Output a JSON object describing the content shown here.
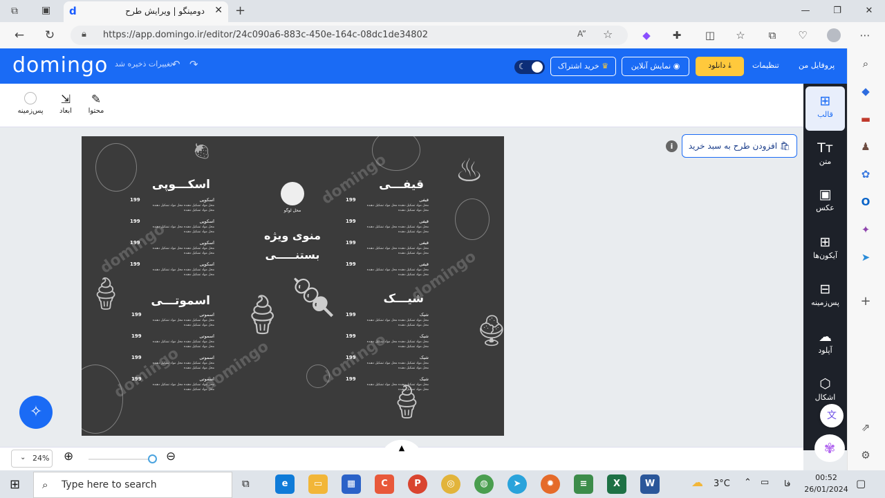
{
  "browser": {
    "tab_title": "دومینگو | ویرایش طرح",
    "url": "https://app.domingo.ir/editor/24c090a6-883c-450e-164c-08dc1de34802"
  },
  "header": {
    "logo": "domingo",
    "saved_text": "تغییرات ذخیره شد",
    "profile": "پروفایل من",
    "settings": "تنظیمات",
    "download": "دانلود",
    "preview": "نمایش آنلاین",
    "subscribe": "خرید اشتراک"
  },
  "toolbar": {
    "background": "پس‌زمینه",
    "dimensions": "ابعاد",
    "content": "محتوا"
  },
  "sidebar": {
    "items": [
      {
        "label": "قالب"
      },
      {
        "label": "متن"
      },
      {
        "label": "عکس"
      },
      {
        "label": "آیکون‌ها"
      },
      {
        "label": "پس‌زمینه"
      },
      {
        "label": "آپلود"
      },
      {
        "label": "اشکال"
      }
    ]
  },
  "cart_button": "افزودن طرح به سبد خرید",
  "zoom": "24%",
  "menu": {
    "logo_text": "محل لوگو",
    "title_line1": "منوی ویژه",
    "title_line2": "بستنـــــی",
    "sections": {
      "ghifi": "قیفـــی",
      "scoopi": "اسکـــوپی",
      "shake": "شیـــک",
      "smoothie": "اسموتـــی"
    },
    "item_names": {
      "ghifi": "قیفی",
      "scoopi": "اسکوپی",
      "shake": "شیک",
      "smoothie": "اسموتی"
    },
    "price": "199",
    "desc": "محل مواد تشکیل دهنده محل مواد تشکیل دهنده محل مواد تشکیل دهنده",
    "watermark": "domingo"
  },
  "taskbar": {
    "search_placeholder": "Type here to search",
    "temperature": "3°C",
    "lang": "فا",
    "time": "00:52",
    "date": "26/01/2024"
  }
}
